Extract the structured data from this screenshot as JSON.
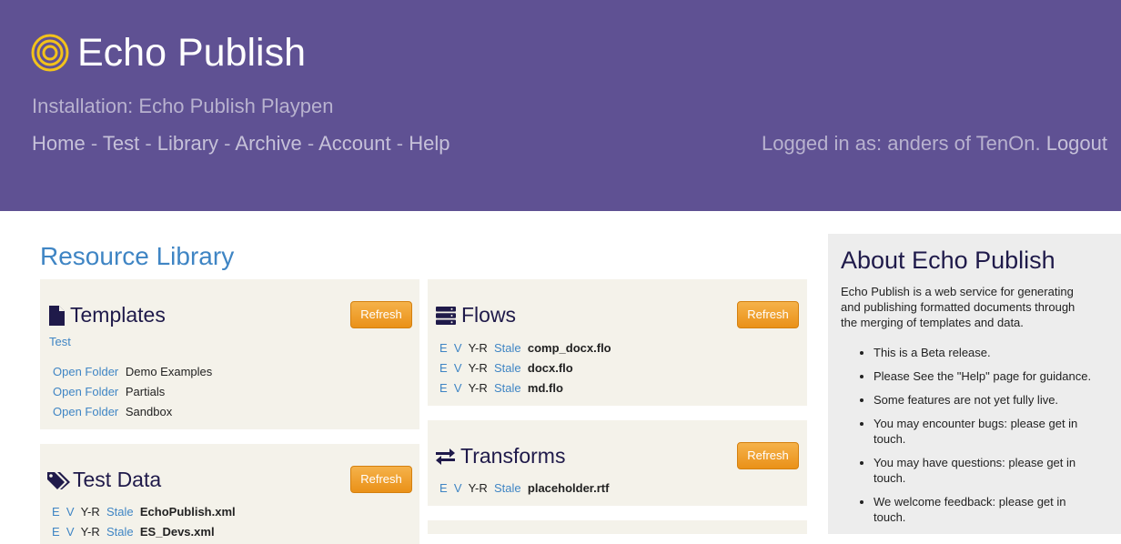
{
  "header": {
    "app_title": "Echo Publish",
    "installation": "Installation: Echo Publish Playpen",
    "nav": [
      "Home",
      "Test",
      "Library",
      "Archive",
      "Account",
      "Help"
    ],
    "nav_separator": "-",
    "login_text": "Logged in as: anders of TenOn.",
    "logout_label": "Logout",
    "colors": {
      "header_bg": "#5f5193",
      "logo": "#f2c21b"
    }
  },
  "page": {
    "heading": "Resource Library"
  },
  "templates": {
    "title": "Templates",
    "refresh_label": "Refresh",
    "test_link": "Test",
    "folders": [
      {
        "action": "Open Folder",
        "name": "Demo Examples"
      },
      {
        "action": "Open Folder",
        "name": "Partials"
      },
      {
        "action": "Open Folder",
        "name": "Sandbox"
      }
    ]
  },
  "test_data": {
    "title": "Test Data",
    "refresh_label": "Refresh",
    "items": [
      {
        "e": "E",
        "v": "V",
        "yr": "Y-R",
        "status": "Stale",
        "file": "EchoPublish.xml"
      },
      {
        "e": "E",
        "v": "V",
        "yr": "Y-R",
        "status": "Stale",
        "file": "ES_Devs.xml"
      }
    ]
  },
  "flows": {
    "title": "Flows",
    "refresh_label": "Refresh",
    "items": [
      {
        "e": "E",
        "v": "V",
        "yr": "Y-R",
        "status": "Stale",
        "file": "comp_docx.flo"
      },
      {
        "e": "E",
        "v": "V",
        "yr": "Y-R",
        "status": "Stale",
        "file": "docx.flo"
      },
      {
        "e": "E",
        "v": "V",
        "yr": "Y-R",
        "status": "Stale",
        "file": "md.flo"
      }
    ]
  },
  "transforms": {
    "title": "Transforms",
    "refresh_label": "Refresh",
    "items": [
      {
        "e": "E",
        "v": "V",
        "yr": "Y-R",
        "status": "Stale",
        "file": "placeholder.rtf"
      }
    ]
  },
  "about": {
    "title": "About Echo Publish",
    "description": "Echo Publish is a web service for generating and publishing formatted documents through the merging of templates and data.",
    "bullets": [
      "This is a Beta release.",
      "Please See the \"Help\" page for guidance.",
      "Some features are not yet fully live.",
      "You may encounter bugs: please get in touch.",
      "You may have questions: please get in touch.",
      "We welcome feedback: please get in touch."
    ]
  }
}
